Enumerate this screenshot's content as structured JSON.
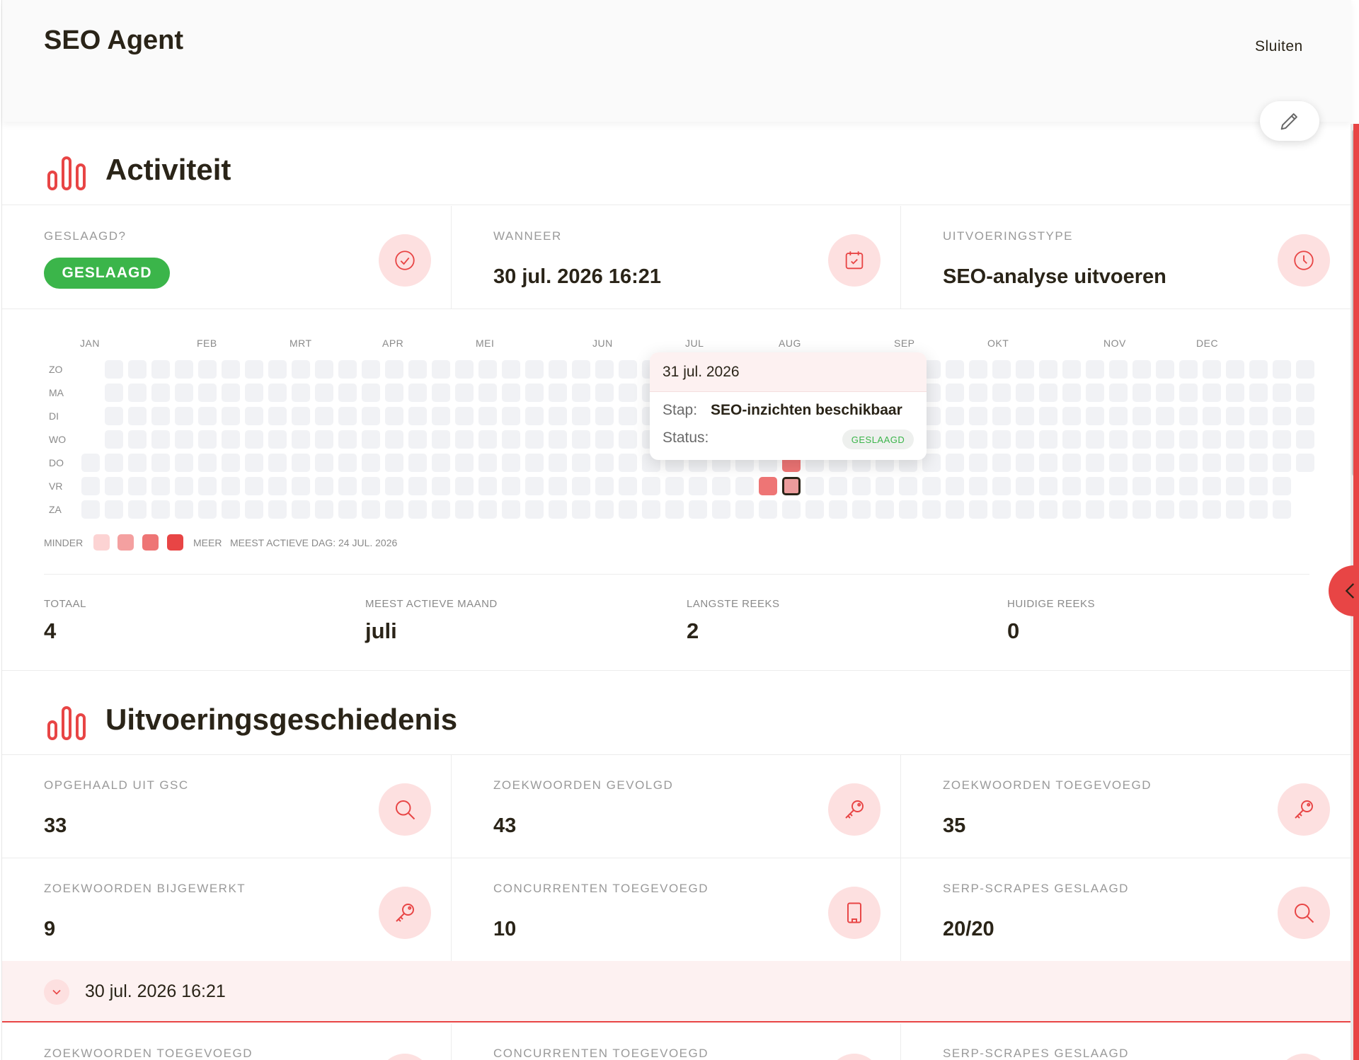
{
  "app": {
    "title": "SEO Agent",
    "close_label": "Sluiten"
  },
  "colors": {
    "accent": "#e84545",
    "success": "#3bb54a",
    "icon_bg": "#fde0e0"
  },
  "activity": {
    "title": "Activiteit",
    "stats": [
      {
        "label": "GESLAAGD?",
        "badge": "GESLAAGD",
        "icon": "check-circle-icon"
      },
      {
        "label": "WANNEER",
        "value": "30 jul. 2026 16:21",
        "icon": "calendar-check-icon"
      },
      {
        "label": "UITVOERINGSTYPE",
        "value": "SEO-analyse uitvoeren",
        "icon": "clock-icon"
      }
    ],
    "heatmap": {
      "months": [
        "JAN",
        "FEB",
        "MRT",
        "APR",
        "MEI",
        "JUN",
        "JUL",
        "AUG",
        "SEP",
        "OKT",
        "NOV",
        "DEC"
      ],
      "days": [
        "ZO",
        "MA",
        "DI",
        "WO",
        "DO",
        "VR",
        "ZA"
      ],
      "active_days": [
        {
          "date": "2026-07-24",
          "level": 2
        },
        {
          "date": "2026-07-30",
          "level": 2
        },
        {
          "date": "2026-07-31",
          "level": 1,
          "selected": true
        }
      ],
      "legend": {
        "less": "MINDER",
        "more": "MEER",
        "most_active": "MEEST ACTIEVE DAG: 24 JUL. 2026",
        "levels": [
          "#fcd3d3",
          "#f4a0a0",
          "#ee7575",
          "#e84545"
        ]
      },
      "tooltip": {
        "date": "31 jul. 2026",
        "step_label": "Stap:",
        "step_value": "SEO-inzichten beschikbaar",
        "status_label": "Status:",
        "status_value": "GESLAAGD"
      }
    },
    "summary": [
      {
        "label": "TOTAAL",
        "value": "4"
      },
      {
        "label": "MEEST ACTIEVE MAAND",
        "value": "juli"
      },
      {
        "label": "LANGSTE REEKS",
        "value": "2"
      },
      {
        "label": "HUIDIGE REEKS",
        "value": "0"
      }
    ]
  },
  "history": {
    "title": "Uitvoeringsgeschiedenis",
    "stats": [
      {
        "label": "OPGEHAALD UIT GSC",
        "value": "33",
        "icon": "search-icon"
      },
      {
        "label": "ZOEKWOORDEN GEVOLGD",
        "value": "43",
        "icon": "key-icon"
      },
      {
        "label": "ZOEKWOORDEN TOEGEVOEGD",
        "value": "35",
        "icon": "key-icon"
      },
      {
        "label": "ZOEKWOORDEN BIJGEWERKT",
        "value": "9",
        "icon": "key-icon"
      },
      {
        "label": "CONCURRENTEN TOEGEVOEGD",
        "value": "10",
        "icon": "building-icon"
      },
      {
        "label": "SERP-SCRAPES GESLAAGD",
        "value": "20/20",
        "icon": "search-icon"
      }
    ],
    "run": {
      "label": "30 jul. 2026 16:21"
    },
    "peek": [
      "ZOEKWOORDEN TOEGEVOEGD",
      "CONCURRENTEN TOEGEVOEGD",
      "SERP-SCRAPES GESLAAGD"
    ]
  }
}
